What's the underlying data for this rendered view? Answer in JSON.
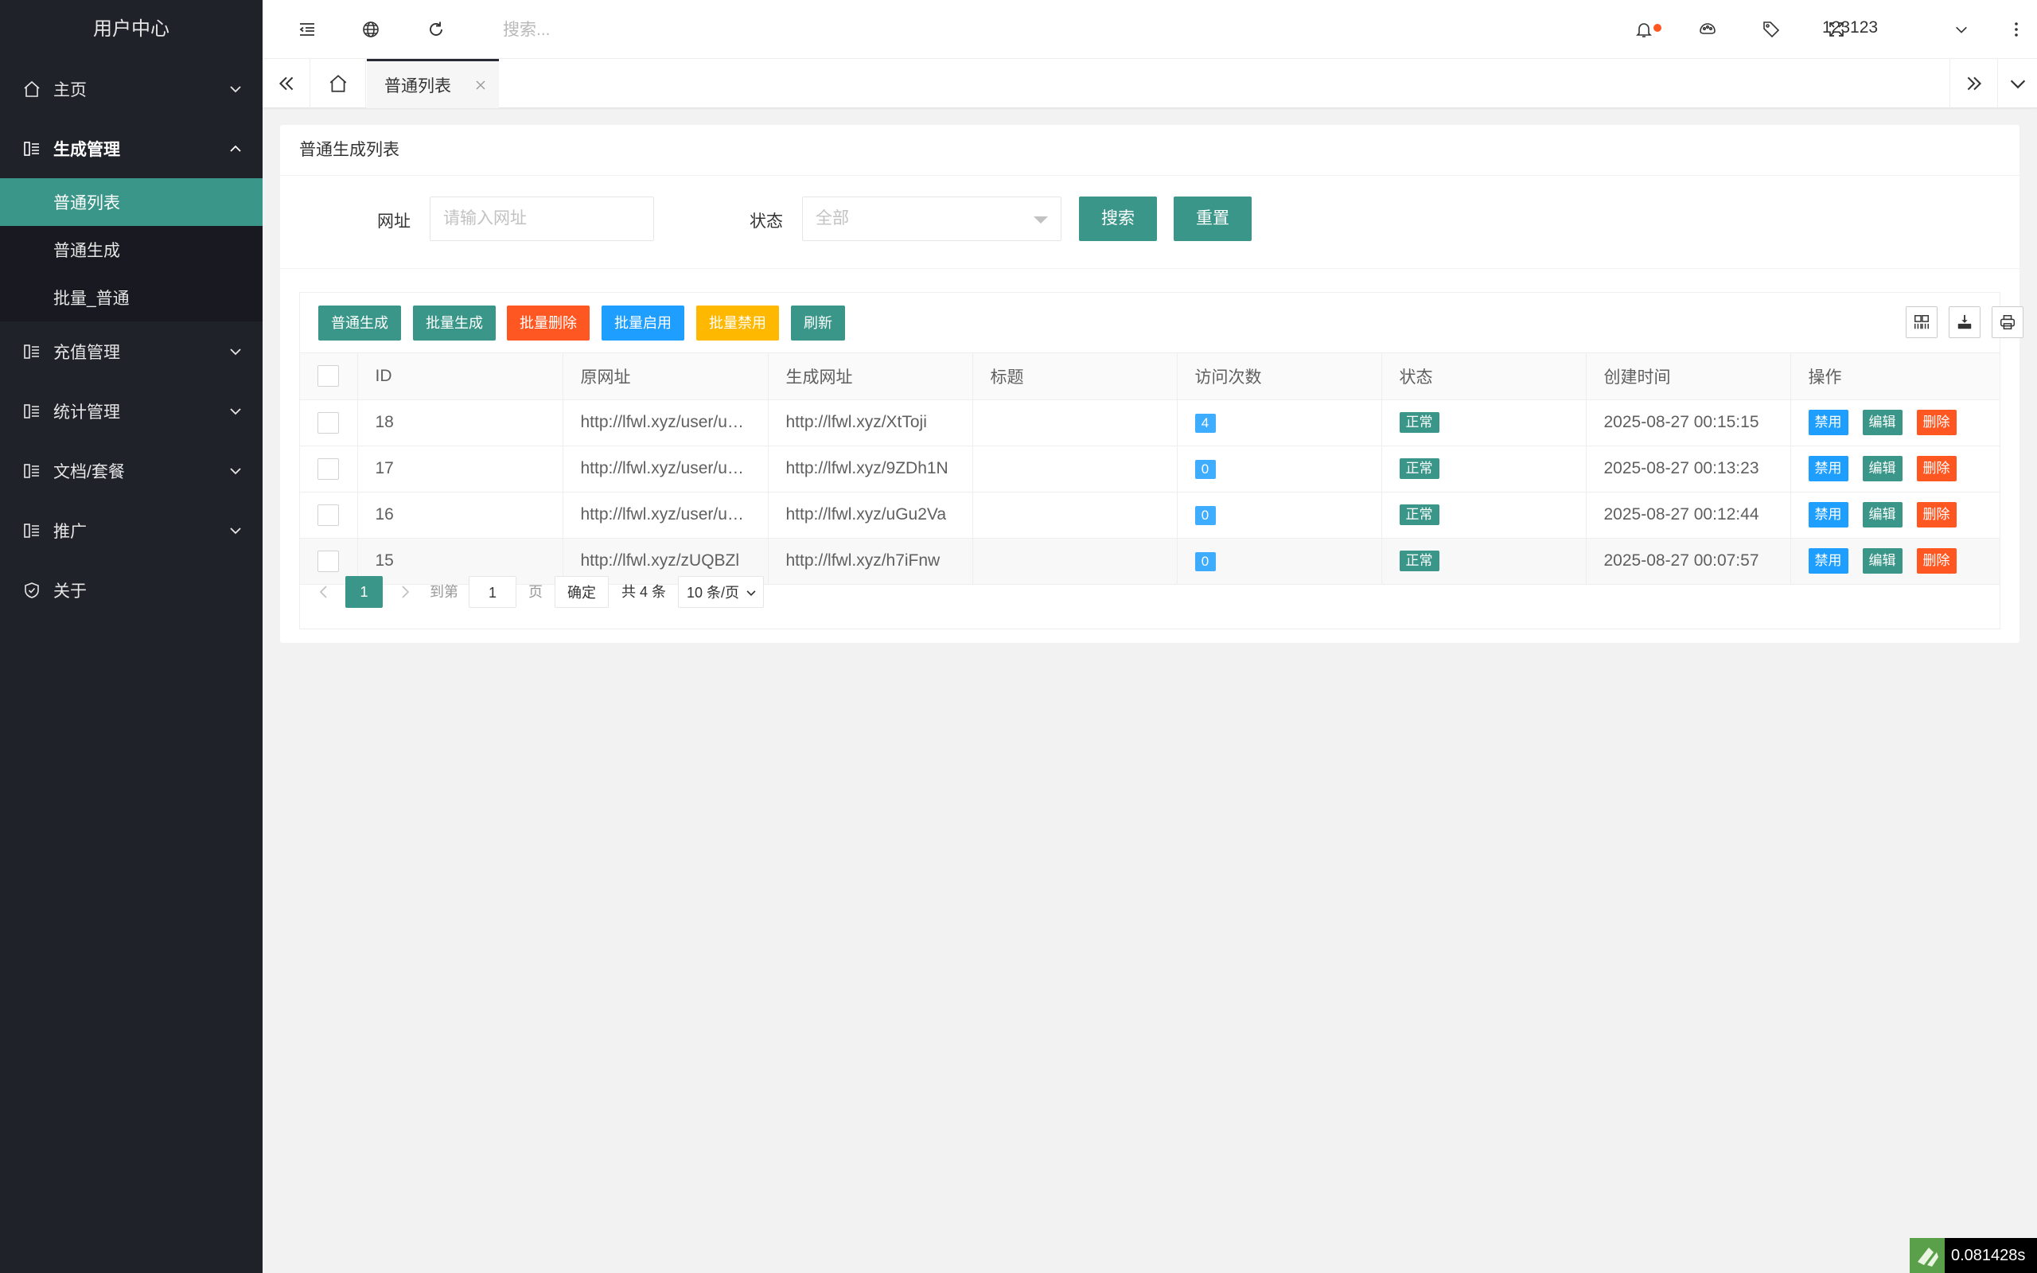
{
  "sidebar": {
    "title": "用户中心",
    "items": [
      {
        "label": "主页"
      },
      {
        "label": "生成管理"
      },
      {
        "label": "充值管理"
      },
      {
        "label": "统计管理"
      },
      {
        "label": "文档/套餐"
      },
      {
        "label": "推广"
      },
      {
        "label": "关于"
      }
    ],
    "submenu": [
      {
        "label": "普通列表"
      },
      {
        "label": "普通生成"
      },
      {
        "label": "批量_普通"
      }
    ]
  },
  "header": {
    "search_placeholder": "搜索...",
    "user": "123123"
  },
  "tabs": {
    "active_label": "普通列表"
  },
  "card": {
    "title": "普通生成列表",
    "form": {
      "url_label": "网址",
      "url_placeholder": "请输入网址",
      "status_label": "状态",
      "status_value": "全部",
      "search_btn": "搜索",
      "reset_btn": "重置"
    },
    "toolbar": {
      "btn_generate": "普通生成",
      "btn_batch_generate": "批量生成",
      "btn_batch_delete": "批量删除",
      "btn_batch_enable": "批量启用",
      "btn_batch_disable": "批量禁用",
      "btn_refresh": "刷新"
    },
    "table": {
      "headers": [
        "ID",
        "原网址",
        "生成网址",
        "标题",
        "访问次数",
        "状态",
        "创建时间",
        "操作"
      ],
      "rows": [
        {
          "id": "18",
          "orig": "http://lfwl.xyz/user/u…",
          "gen": "http://lfwl.xyz/XtToji",
          "title": "",
          "visits": "4",
          "status": "正常",
          "created": "2025-08-27 00:15:15"
        },
        {
          "id": "17",
          "orig": "http://lfwl.xyz/user/u…",
          "gen": "http://lfwl.xyz/9ZDh1N",
          "title": "",
          "visits": "0",
          "status": "正常",
          "created": "2025-08-27 00:13:23"
        },
        {
          "id": "16",
          "orig": "http://lfwl.xyz/user/u…",
          "gen": "http://lfwl.xyz/uGu2Va",
          "title": "",
          "visits": "0",
          "status": "正常",
          "created": "2025-08-27 00:12:44"
        },
        {
          "id": "15",
          "orig": "http://lfwl.xyz/zUQBZl",
          "gen": "http://lfwl.xyz/h7iFnw",
          "title": "",
          "visits": "0",
          "status": "正常",
          "created": "2025-08-27 00:07:57"
        }
      ],
      "ops": {
        "disable": "禁用",
        "edit": "编辑",
        "delete": "删除"
      }
    },
    "pager": {
      "current": "1",
      "goto_label": "到第",
      "goto_value": "1",
      "page_suffix": "页",
      "confirm": "确定",
      "total": "共 4 条",
      "page_size": "10 条/页"
    }
  },
  "footer": {
    "timer": "0.081428s"
  }
}
